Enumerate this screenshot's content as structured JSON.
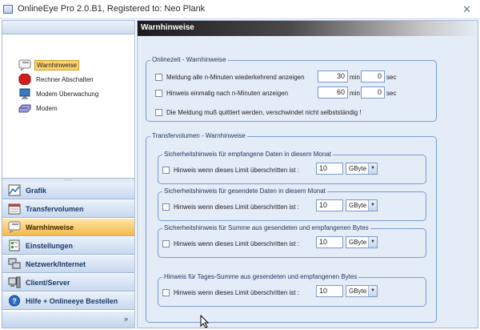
{
  "window": {
    "title": "OnlineEye Pro 2.0.B1, Registered to: Neo Plank",
    "close_glyph": "✕"
  },
  "tree": {
    "items": [
      {
        "label": "Warnhinweise",
        "icon": "warning-icon",
        "selected": true
      },
      {
        "label": "Rechner Abschalten",
        "icon": "stop-icon",
        "selected": false
      },
      {
        "label": "Modem Überwachung",
        "icon": "monitor-icon",
        "selected": false
      },
      {
        "label": "Modem",
        "icon": "modem-icon",
        "selected": false
      }
    ]
  },
  "splitter_grip": "......",
  "nav": {
    "items": [
      {
        "label": "Grafik",
        "icon": "chart-icon"
      },
      {
        "label": "Transfervolumen",
        "icon": "calendar-icon"
      },
      {
        "label": "Warnhinweise",
        "icon": "warning-icon",
        "active": true
      },
      {
        "label": "Einstellungen",
        "icon": "settings-icon"
      },
      {
        "label": "Netzwerk/Internet",
        "icon": "network-icon"
      },
      {
        "label": "Client/Server",
        "icon": "server-icon"
      },
      {
        "label": "Hilfe + Onlineeye Bestellen",
        "icon": "help-icon"
      }
    ],
    "more_glyph": "»"
  },
  "content": {
    "title": "Warnhinweise",
    "onlinezeit": {
      "legend": "Onlinezeit - Warnhinweise",
      "row1": {
        "label": "Meldung alle n-Minuten wiederkehrend anzeigen",
        "min_value": "30",
        "min_unit": "min",
        "sec_value": "0",
        "sec_unit": "sec"
      },
      "row2": {
        "label": "Hinweis einmalig nach n-Minuten anzeigen",
        "min_value": "60",
        "min_unit": "min",
        "sec_value": "0",
        "sec_unit": "sec"
      },
      "row3": {
        "label": "Die Meldung muß quittiert werden, verschwindet nicht selbstständig !"
      }
    },
    "transfer": {
      "legend": "Transfervolumen - Warnhinweise",
      "groups": [
        {
          "legend": "Sicherheitshinweis für empfangene Daten in diesem Monat",
          "label": "Hinweis wenn dieses Limit überschritten ist :",
          "value": "10",
          "unit": "GByte"
        },
        {
          "legend": "Sicherheitshinweis für gesendete Daten in diesem Monat",
          "label": "Hinweis wenn dieses Limit überschritten ist :",
          "value": "10",
          "unit": "GByte"
        },
        {
          "legend": "Sicherheitshinweis für Summe aus gesendeten und empfangenen Bytes",
          "label": "Hinweis wenn dieses Limit überschritten ist :",
          "value": "10",
          "unit": "GByte"
        },
        {
          "legend": "Hinweis für Tages-Summe aus gesendeten und empfangenen Bytes",
          "label": "Hinweis wenn dieses Limit überschritten ist :",
          "value": "10",
          "unit": "GByte"
        }
      ],
      "dropdown_glyph": "▼"
    }
  },
  "colors": {
    "accent": "#f5b94a",
    "header_dark": "#1c1c1c",
    "group_border": "#7a9bcf"
  }
}
